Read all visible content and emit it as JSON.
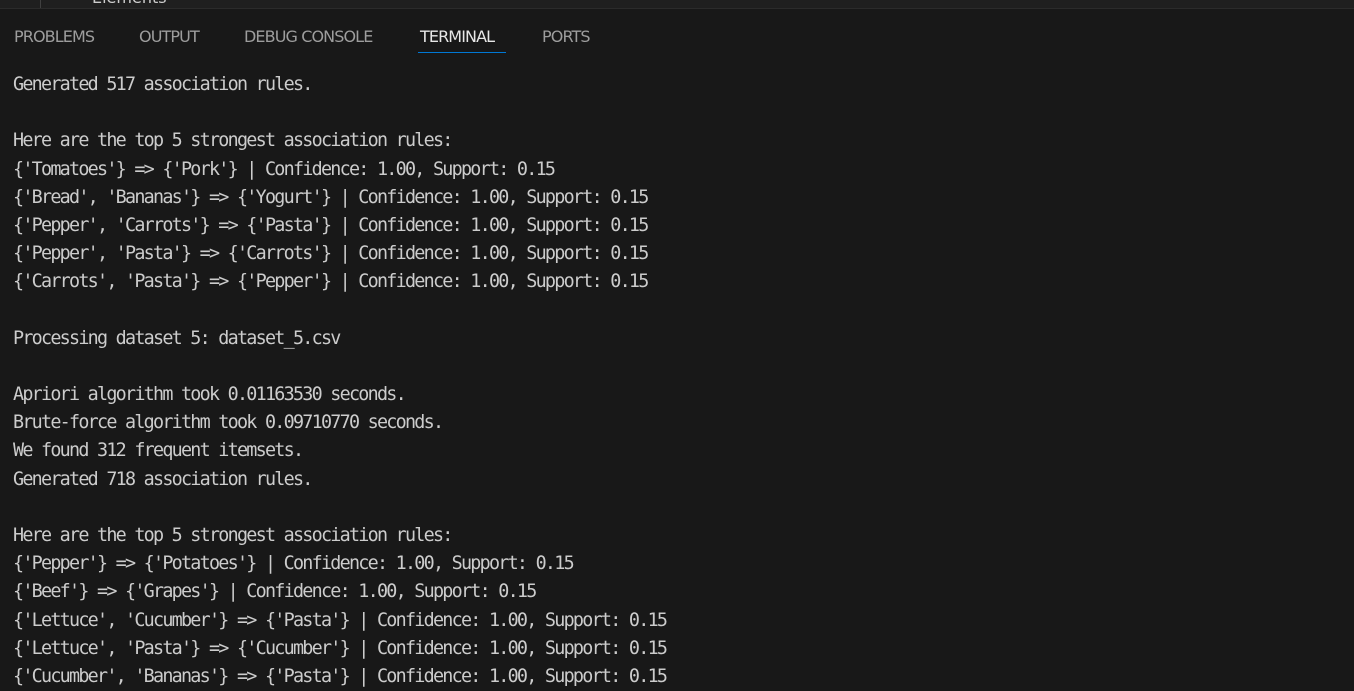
{
  "editor": {
    "clipped_text": "Elements"
  },
  "panel": {
    "tabs": [
      {
        "label": "PROBLEMS"
      },
      {
        "label": "OUTPUT"
      },
      {
        "label": "DEBUG CONSOLE"
      },
      {
        "label": "TERMINAL"
      },
      {
        "label": "PORTS"
      }
    ],
    "active_tab": "TERMINAL"
  },
  "terminal": {
    "lines": [
      "Generated 517 association rules.",
      "",
      "Here are the top 5 strongest association rules:",
      "{'Tomatoes'} => {'Pork'} | Confidence: 1.00, Support: 0.15",
      "{'Bread', 'Bananas'} => {'Yogurt'} | Confidence: 1.00, Support: 0.15",
      "{'Pepper', 'Carrots'} => {'Pasta'} | Confidence: 1.00, Support: 0.15",
      "{'Pepper', 'Pasta'} => {'Carrots'} | Confidence: 1.00, Support: 0.15",
      "{'Carrots', 'Pasta'} => {'Pepper'} | Confidence: 1.00, Support: 0.15",
      "",
      "Processing dataset 5: dataset_5.csv",
      "",
      "Apriori algorithm took 0.01163530 seconds.",
      "Brute-force algorithm took 0.09710770 seconds.",
      "We found 312 frequent itemsets.",
      "Generated 718 association rules.",
      "",
      "Here are the top 5 strongest association rules:",
      "{'Pepper'} => {'Potatoes'} | Confidence: 1.00, Support: 0.15",
      "{'Beef'} => {'Grapes'} | Confidence: 1.00, Support: 0.15",
      "{'Lettuce', 'Cucumber'} => {'Pasta'} | Confidence: 1.00, Support: 0.15",
      "{'Lettuce', 'Pasta'} => {'Cucumber'} | Confidence: 1.00, Support: 0.15",
      "{'Cucumber', 'Bananas'} => {'Pasta'} | Confidence: 1.00, Support: 0.15"
    ]
  }
}
